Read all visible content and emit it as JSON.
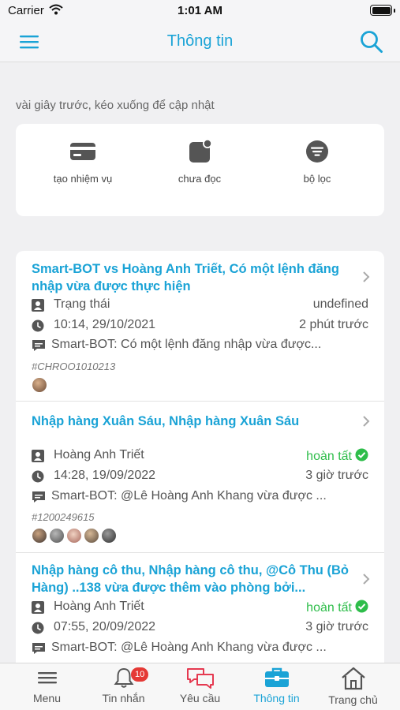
{
  "status_bar": {
    "carrier": "Carrier",
    "time": "1:01 AM"
  },
  "nav": {
    "title": "Thông tin"
  },
  "refresh_hint": "vài giây trước, kéo xuống để cập nhật",
  "actions": [
    {
      "label": "tạo nhiệm vụ",
      "icon": "card-icon"
    },
    {
      "label": "chưa đọc",
      "icon": "unread-icon"
    },
    {
      "label": "bộ lọc",
      "icon": "filter-icon"
    }
  ],
  "items": [
    {
      "title": "Smart-BOT vs Hoàng Anh Triết, Có một lệnh đăng nhập vừa được thực hiện",
      "person": "Trạng thái",
      "status": "undefined",
      "datetime": "10:14, 29/10/2021",
      "ago": "2 phút trước",
      "message": "Smart-BOT: Có một lệnh đăng nhập vừa được...",
      "code": "#CHROO1010213"
    },
    {
      "title": "Nhập hàng Xuân Sáu, Nhập hàng Xuân Sáu",
      "person": "Hoàng Anh Triết",
      "status": "hoàn tất",
      "datetime": "14:28, 19/09/2022",
      "ago": "3 giờ trước",
      "message": "Smart-BOT: @Lê Hoàng Anh Khang vừa được ...",
      "code": "#1200249615"
    },
    {
      "title": "Nhập hàng cô thu, Nhập hàng cô thu, @Cô Thu (Bỏ Hàng) ..138 vừa được thêm vào phòng bởi...",
      "person": "Hoàng Anh Triết",
      "status": "hoàn tất",
      "datetime": "07:55, 20/09/2022",
      "ago": "3 giờ trước",
      "message": "Smart-BOT: @Lê Hoàng Anh Khang vừa được ..."
    }
  ],
  "tabs": [
    {
      "label": "Menu",
      "icon": "menu-icon"
    },
    {
      "label": "Tin nhắn",
      "icon": "bell-icon",
      "badge": "10"
    },
    {
      "label": "Yêu cầu",
      "icon": "chat-bubbles-icon"
    },
    {
      "label": "Thông tin",
      "icon": "briefcase-icon",
      "active": true
    },
    {
      "label": "Trang chủ",
      "icon": "home-icon"
    }
  ],
  "colors": {
    "accent": "#1aa3d6",
    "done": "#2ebd4a",
    "badge": "#e53935",
    "background": "#f0f0f2"
  }
}
